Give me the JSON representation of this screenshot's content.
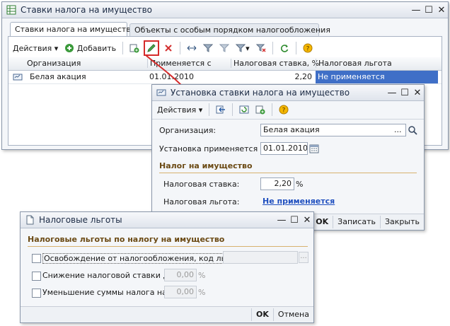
{
  "main": {
    "title": "Ставки налога на имущество",
    "tabs": [
      "Ставки налога на имущество",
      "Объекты с особым порядком налогообложения"
    ],
    "toolbar": {
      "actions": "Действия",
      "add": "Добавить"
    },
    "columns": [
      "Организация",
      "Применяется с",
      "Налоговая ставка, %",
      "Налоговая льгота"
    ],
    "rows": [
      {
        "org": "Белая акация",
        "date": "01.01.2010",
        "rate": "2,20",
        "benefit": "Не применяется"
      }
    ]
  },
  "rate_dialog": {
    "title": "Установка ставки налога на имущество",
    "toolbar": {
      "actions": "Действия"
    },
    "org_label": "Организация:",
    "org_value": "Белая акация",
    "date_label": "Установка применяется с:",
    "date_value": "01.01.2010",
    "section": "Налог на имущество",
    "rate_label": "Налоговая ставка:",
    "rate_value": "2,20",
    "rate_unit": "%",
    "benefit_label": "Налоговая льгота:",
    "benefit_link": "Не применяется",
    "buttons": {
      "ok": "OK",
      "save": "Записать",
      "close": "Закрыть"
    }
  },
  "benefit_dialog": {
    "title": "Налоговые льготы",
    "section": "Налоговые льготы по налогу на имущество",
    "options": [
      {
        "label": "Освобождение от налогообложения, код льготы:",
        "value": ""
      },
      {
        "label": "Снижение налоговой ставки до:",
        "value": "0,00",
        "unit": "%"
      },
      {
        "label": "Уменьшение суммы налога на:",
        "value": "0,00",
        "unit": "%"
      }
    ],
    "buttons": {
      "ok": "OK",
      "cancel": "Отмена"
    }
  },
  "colors": {
    "accent_red": "#d52a2a",
    "selection": "#3f6fc7",
    "section": "#6b4a14"
  }
}
